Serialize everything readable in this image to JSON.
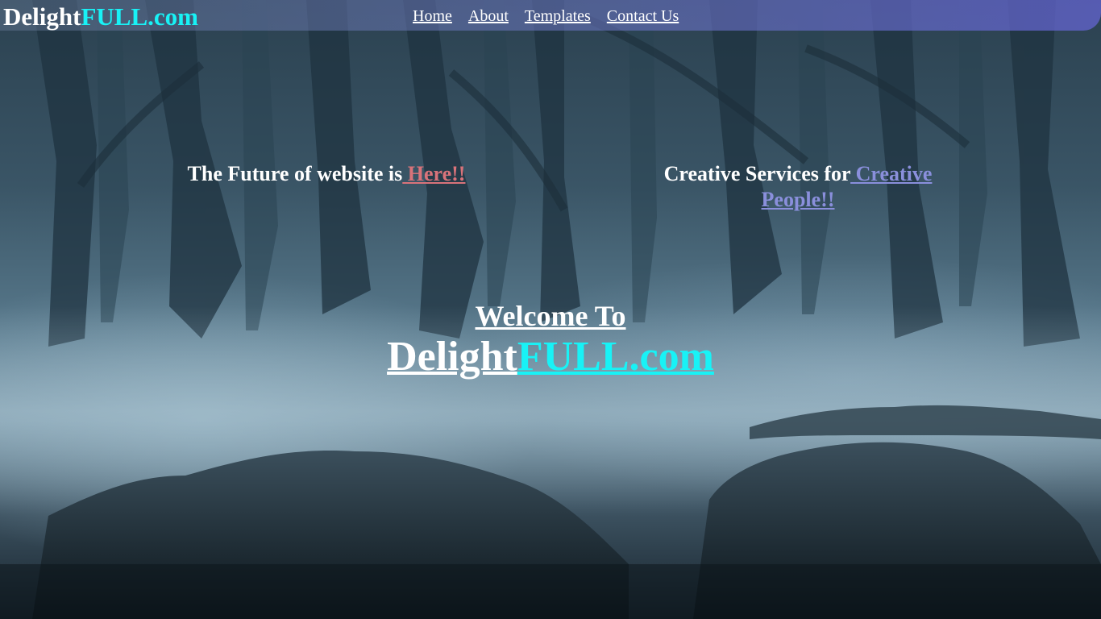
{
  "brand": {
    "part1": "Delight",
    "part2": "FULL.com"
  },
  "nav": {
    "items": [
      {
        "label": "Home"
      },
      {
        "label": "About"
      },
      {
        "label": "Templates"
      },
      {
        "label": "Contact Us"
      }
    ]
  },
  "taglines": {
    "left": {
      "text": "The Future of website is",
      "link": " Here!!"
    },
    "right": {
      "text": "Creative Services for",
      "link": " Creative People!!"
    }
  },
  "hero": {
    "welcome": "Welcome To",
    "title_part1": "Delight",
    "title_part2": "FULL.com"
  },
  "colors": {
    "accent_cyan": "#18f2f6",
    "link_red": "#d9737a",
    "link_purple": "#8a8fdc",
    "navbar_purple": "#6f6fd0"
  },
  "background": {
    "image": "misty-forest-background"
  }
}
